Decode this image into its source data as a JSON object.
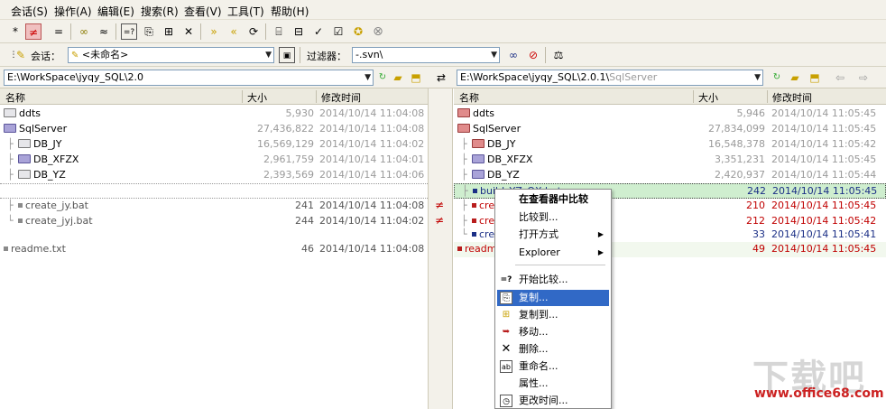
{
  "menu": [
    "会话(S)",
    "操作(A)",
    "编辑(E)",
    "搜索(R)",
    "查看(V)",
    "工具(T)",
    "帮助(H)"
  ],
  "toolbar2": {
    "session_label": "会话：",
    "session_value": "<未命名>",
    "filter_label": "过滤器：",
    "filter_value": "-.svn\\"
  },
  "left_pane": {
    "path": "E:\\WorkSpace\\jyqy_SQL\\2.0",
    "columns": [
      "名称",
      "大小",
      "修改时间"
    ],
    "rows": [
      {
        "name": "ddts",
        "size": "5,930",
        "date": "2014/10/14 11:04:08"
      },
      {
        "name": "SqlServer",
        "size": "27,436,822",
        "date": "2014/10/14 11:04:08"
      },
      {
        "name": "DB_JY",
        "size": "16,569,129",
        "date": "2014/10/14 11:04:02"
      },
      {
        "name": "DB_XFZX",
        "size": "2,961,759",
        "date": "2014/10/14 11:04:01"
      },
      {
        "name": "DB_YZ",
        "size": "2,393,569",
        "date": "2014/10/14 11:04:06"
      },
      {
        "name": "create_jy.bat",
        "size": "241",
        "date": "2014/10/14 11:04:08"
      },
      {
        "name": "create_jyj.bat",
        "size": "244",
        "date": "2014/10/14 11:04:02"
      },
      {
        "name": "readme.txt",
        "size": "46",
        "date": "2014/10/14 11:04:08"
      }
    ]
  },
  "right_pane": {
    "path": "E:\\WorkSpace\\jyqy_SQL\\2.0.1\\",
    "path_dim": "SqlServer",
    "columns": [
      "名称",
      "大小",
      "修改时间"
    ],
    "rows": [
      {
        "name": "ddts",
        "size": "5,946",
        "date": "2014/10/14 11:05:45"
      },
      {
        "name": "SqlServer",
        "size": "27,834,099",
        "date": "2014/10/14 11:05:45"
      },
      {
        "name": "DB_JY",
        "size": "16,548,378",
        "date": "2014/10/14 11:05:42"
      },
      {
        "name": "DB_XFZX",
        "size": "3,351,231",
        "date": "2014/10/14 11:05:45"
      },
      {
        "name": "DB_YZ",
        "size": "2,420,937",
        "date": "2014/10/14 11:05:44"
      },
      {
        "name": "build_YZ_QX.bat",
        "size": "242",
        "date": "2014/10/14 11:05:45"
      },
      {
        "name": "crea",
        "size": "210",
        "date": "2014/10/14 11:05:45"
      },
      {
        "name": "crea",
        "size": "212",
        "date": "2014/10/14 11:05:42"
      },
      {
        "name": "crea",
        "size": "33",
        "date": "2014/10/14 11:05:41"
      },
      {
        "name": "readm",
        "size": "49",
        "date": "2014/10/14 11:05:45"
      }
    ]
  },
  "context_menu": [
    {
      "label": "在查看器中比较",
      "bold": true
    },
    {
      "label": "比较到..."
    },
    {
      "label": "打开方式",
      "submenu": true
    },
    {
      "label": "Explorer",
      "submenu": true
    },
    {
      "label": "开始比较..."
    },
    {
      "label": "复制...",
      "highlighted": true
    },
    {
      "label": "复制到..."
    },
    {
      "label": "移动..."
    },
    {
      "label": "删除..."
    },
    {
      "label": "重命名..."
    },
    {
      "label": "属性..."
    },
    {
      "label": "更改时间..."
    }
  ],
  "watermark": {
    "brand": "下载吧",
    "url": "www.office68.com"
  },
  "colors": {
    "diff_red": "#c00000",
    "newer_blue": "#1b2f86",
    "selection": "#3169c6",
    "selected_row": "#cfeecf"
  }
}
